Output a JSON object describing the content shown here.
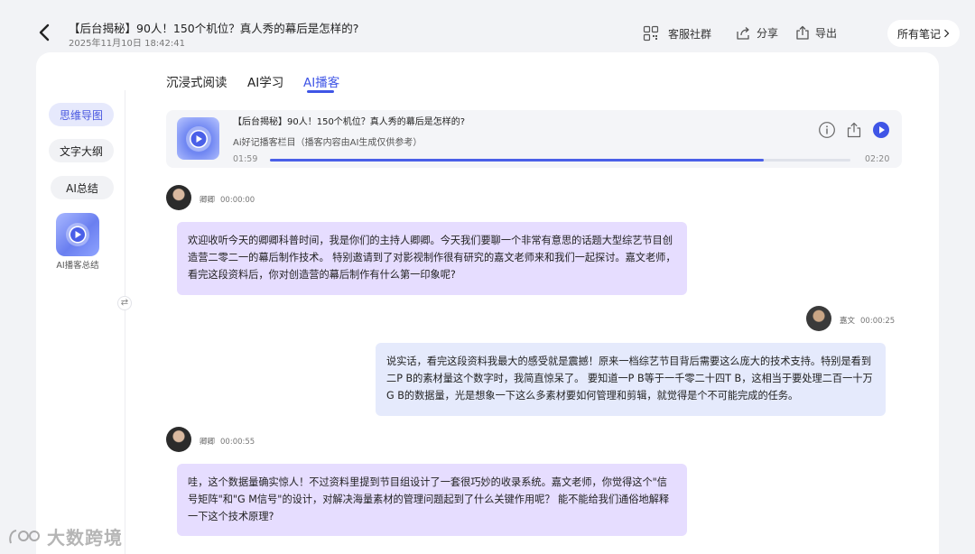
{
  "header": {
    "title": "【后台揭秘】90人！150个机位？真人秀的幕后是怎样的?",
    "date": "2025年11月10日 18:42:41",
    "actions": {
      "community": "客服社群",
      "share": "分享",
      "export": "导出",
      "all_notes": "所有笔记"
    }
  },
  "sidebar": {
    "items": [
      {
        "label": "思维导图",
        "active": true
      },
      {
        "label": "文字大纲",
        "active": false
      },
      {
        "label": "AI总结",
        "active": false
      }
    ],
    "podcast_label": "AI播客总结",
    "toggle_glyph": "⇄"
  },
  "tabs": [
    {
      "label": "沉浸式阅读",
      "active": false
    },
    {
      "label": "AI学习",
      "active": false
    },
    {
      "label": "AI播客",
      "active": true
    }
  ],
  "player": {
    "title": "【后台揭秘】90人！150个机位？真人秀的幕后是怎样的?",
    "subtitle": "Ai好记播客栏目（播客内容由AI生成仅供参考）",
    "current_time": "01:59",
    "total_time": "02:20",
    "progress": 0.85,
    "icons": [
      "info-icon",
      "share-icon",
      "play-icon"
    ]
  },
  "transcript": [
    {
      "speaker": "卿卿",
      "time": "00:00:00",
      "role": "host",
      "text": "欢迎收听今天的卿卿科普时间，我是你们的主持人卿卿。今天我们要聊一个非常有意思的话题大型综艺节目创造营二零二一的幕后制作技术。 特别邀请到了对影视制作很有研究的嘉文老师来和我们一起探讨。嘉文老师，看完这段资料后，你对创造营的幕后制作有什么第一印象呢?"
    },
    {
      "speaker": "嘉文",
      "time": "00:00:25",
      "role": "guest",
      "text": "说实话，看完这段资料我最大的感受就是震撼！原来一档综艺节目背后需要这么庞大的技术支持。特别是看到二P B的素材量这个数字时，我简直惊呆了。 要知道一P B等于一千零二十四T B，这相当于要处理二百一十万G B的数据量，光是想象一下这么多素材要如何管理和剪辑，就觉得是个不可能完成的任务。"
    },
    {
      "speaker": "卿卿",
      "time": "00:00:55",
      "role": "host",
      "text": "哇，这个数据量确实惊人！不过资料里提到节目组设计了一套很巧妙的收录系统。嘉文老师，你觉得这个\"信号矩阵\"和\"G M信号\"的设计，对解决海量素材的管理问题起到了什么关键作用呢？ 能不能给我们通俗地解释一下这个技术原理?"
    }
  ],
  "watermark": "大数跨境",
  "colors": {
    "accent": "#3f55e6",
    "host_bubble": "#e6ddff",
    "guest_bubble": "#e5eafc"
  }
}
